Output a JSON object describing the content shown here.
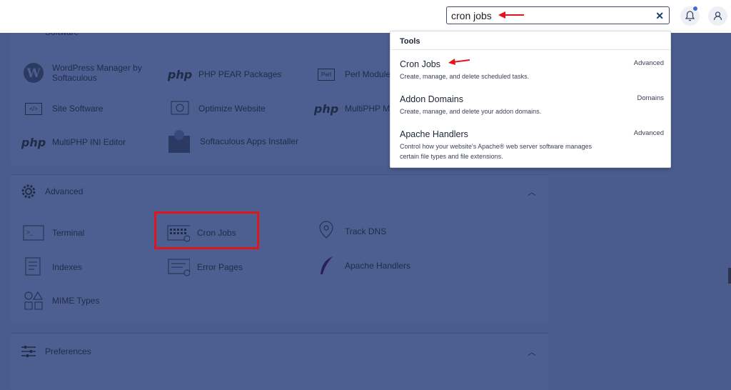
{
  "search": {
    "value": "cron jobs"
  },
  "software": {
    "title": "Software",
    "items": [
      {
        "label": "WordPress Manager by Softaculous",
        "icon": "wordpress-icon"
      },
      {
        "label": "PHP PEAR Packages",
        "icon": "php-icon"
      },
      {
        "label": "Perl Modules",
        "icon": "perl-icon"
      },
      {
        "label": "Site Software",
        "icon": "code-icon"
      },
      {
        "label": "Optimize Website",
        "icon": "optimize-icon"
      },
      {
        "label": "MultiPHP M",
        "icon": "php-icon"
      },
      {
        "label": "MultiPHP INI Editor",
        "icon": "php-icon"
      },
      {
        "label": "Softaculous Apps Installer",
        "icon": "softaculous-icon"
      }
    ]
  },
  "advanced": {
    "title": "Advanced",
    "items": [
      {
        "label": "Terminal",
        "icon": "terminal-icon"
      },
      {
        "label": "Cron Jobs",
        "icon": "calendar-clock-icon"
      },
      {
        "label": "Track DNS",
        "icon": "location-pin-icon"
      },
      {
        "label": "Indexes",
        "icon": "indexes-icon"
      },
      {
        "label": "Error Pages",
        "icon": "error-pages-icon"
      },
      {
        "label": "Apache Handlers",
        "icon": "feather-icon"
      },
      {
        "label": "MIME Types",
        "icon": "shapes-icon"
      }
    ]
  },
  "preferences": {
    "title": "Preferences"
  },
  "dropdown": {
    "heading": "Tools",
    "results": [
      {
        "title": "Cron Jobs",
        "desc": "Create, manage, and delete scheduled tasks.",
        "category": "Advanced"
      },
      {
        "title": "Addon Domains",
        "desc": "Create, manage, and delete your addon domains.",
        "category": "Domains"
      },
      {
        "title": "Apache Handlers",
        "desc": "Control how your website's Apache® web server software manages certain file types and file extensions.",
        "category": "Advanced"
      }
    ]
  },
  "colors": {
    "highlight": "#e3131b",
    "overlay": "#4a5c8c",
    "accent": "#3b6fd8"
  }
}
